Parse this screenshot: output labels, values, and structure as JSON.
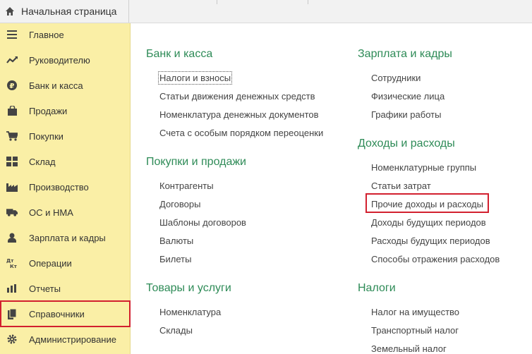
{
  "top": {
    "home_label": "Начальная страница"
  },
  "sidebar": {
    "items": [
      {
        "label": "Главное",
        "icon": "menu-lines-icon"
      },
      {
        "label": "Руководителю",
        "icon": "trend-icon"
      },
      {
        "label": "Банк и касса",
        "icon": "ruble-icon"
      },
      {
        "label": "Продажи",
        "icon": "shopping-bag-icon"
      },
      {
        "label": "Покупки",
        "icon": "cart-icon"
      },
      {
        "label": "Склад",
        "icon": "warehouse-grid-icon"
      },
      {
        "label": "Производство",
        "icon": "factory-icon"
      },
      {
        "label": "ОС и НМА",
        "icon": "truck-icon"
      },
      {
        "label": "Зарплата и кадры",
        "icon": "person-icon"
      },
      {
        "label": "Операции",
        "icon": "dt-kt-icon"
      },
      {
        "label": "Отчеты",
        "icon": "bar-chart-icon"
      },
      {
        "label": "Справочники",
        "icon": "books-icon"
      },
      {
        "label": "Администрирование",
        "icon": "gear-icon"
      }
    ],
    "selected_index": 11
  },
  "content": {
    "left_column": [
      {
        "title": "Банк и касса",
        "links": [
          "Налоги и взносы",
          "Статьи движения денежных средств",
          "Номенклатура денежных документов",
          "Счета с особым порядком переоценки"
        ]
      },
      {
        "title": "Покупки и продажи",
        "links": [
          "Контрагенты",
          "Договоры",
          "Шаблоны договоров",
          "Валюты",
          "Билеты"
        ]
      },
      {
        "title": "Товары и услуги",
        "links": [
          "Номенклатура",
          "Склады"
        ]
      }
    ],
    "right_column": [
      {
        "title": "Зарплата и кадры",
        "links": [
          "Сотрудники",
          "Физические лица",
          "Графики работы"
        ]
      },
      {
        "title": "Доходы и расходы",
        "links": [
          "Номенклатурные группы",
          "Статьи затрат",
          "Прочие доходы и расходы",
          "Доходы будущих периодов",
          "Расходы будущих периодов",
          "Способы отражения расходов"
        ]
      },
      {
        "title": "Налоги",
        "links": [
          "Налог на имущество",
          "Транспортный налог",
          "Земельный налог"
        ]
      }
    ],
    "focused_link": "Налоги и взносы",
    "highlighted_link": "Прочие доходы и расходы"
  },
  "colors": {
    "sidebar_bg": "#faefa6",
    "group_title": "#2e8b57",
    "highlight": "#d2202f"
  }
}
